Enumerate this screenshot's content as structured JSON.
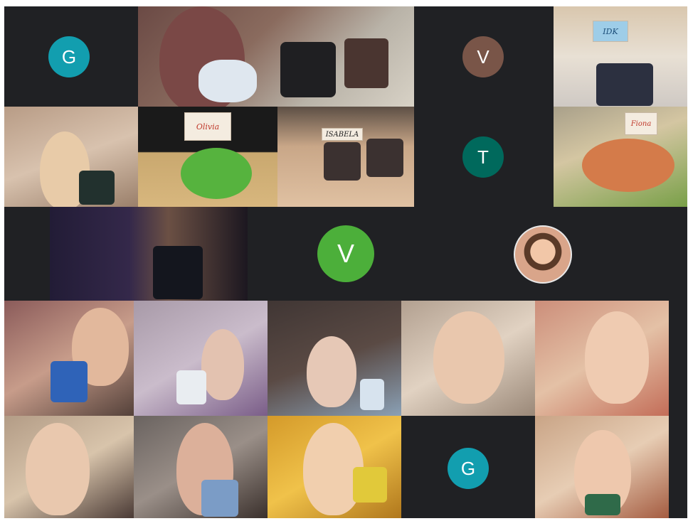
{
  "meeting": {
    "participants": [
      {
        "initial": "G",
        "color": "#129eaf"
      },
      {
        "initial": "V",
        "color": "#795548"
      },
      {
        "initial": "T",
        "color": "#00695c"
      },
      {
        "initial": "V",
        "color": "#4caf3a"
      },
      {
        "initial": "G",
        "color": "#129eaf"
      }
    ],
    "signs": {
      "sign_a": "Olivia",
      "sign_b": "ISABELA",
      "sign_c": "IDK",
      "sign_d": "Fiona"
    }
  }
}
